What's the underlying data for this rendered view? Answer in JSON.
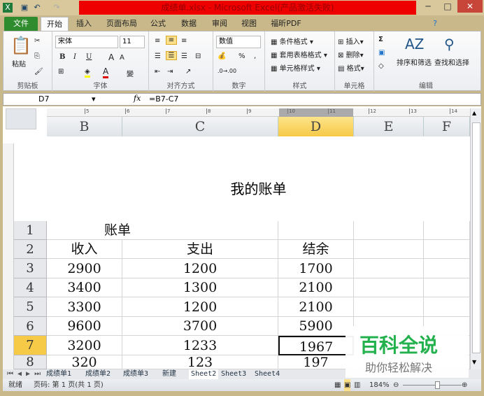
{
  "window": {
    "title": "成绩单.xlsx - Microsoft Excel(产品激活失败)",
    "minimize": "─",
    "maximize": "□",
    "close": "✕"
  },
  "ribbon_tabs": [
    "文件",
    "开始",
    "插入",
    "页面布局",
    "公式",
    "数据",
    "审阅",
    "视图",
    "福昕PDF"
  ],
  "ribbon": {
    "clipboard": {
      "paste": "粘贴",
      "label": "剪贴板"
    },
    "font": {
      "name": "宋体",
      "size": "11",
      "bold": "B",
      "italic": "I",
      "underline": "U",
      "grow": "A",
      "shrink": "A",
      "label": "字体"
    },
    "alignment": {
      "label": "对齐方式"
    },
    "number": {
      "format": "数值",
      "percent": "%",
      "comma": ",",
      "label": "数字"
    },
    "styles": {
      "conditional": "条件格式",
      "table": "套用表格格式",
      "cell": "单元格样式",
      "label": "样式"
    },
    "cells": {
      "insert": "插入",
      "delete": "删除",
      "format": "格式",
      "label": "单元格"
    },
    "editing": {
      "sort": "排序和筛选",
      "find": "查找和选择",
      "sigma": "Σ",
      "label": "编辑"
    }
  },
  "formula_bar": {
    "name_box": "D7",
    "fx": "fx",
    "formula": "=B7-C7"
  },
  "ruler_ticks": [
    "5",
    "6",
    "7",
    "8",
    "9",
    "10",
    "11",
    "12",
    "13",
    "14"
  ],
  "columns": [
    "B",
    "C",
    "D",
    "E",
    "F"
  ],
  "active_column": "D",
  "page_header": "我的账单",
  "rows": [
    {
      "n": "1",
      "cells": [
        "账单",
        "",
        "",
        ""
      ]
    },
    {
      "n": "2",
      "cells": [
        "收入",
        "支出",
        "结余",
        ""
      ]
    },
    {
      "n": "3",
      "cells": [
        "2900",
        "1200",
        "1700",
        ""
      ]
    },
    {
      "n": "4",
      "cells": [
        "3400",
        "1300",
        "2100",
        ""
      ]
    },
    {
      "n": "5",
      "cells": [
        "3300",
        "1200",
        "2100",
        ""
      ]
    },
    {
      "n": "6",
      "cells": [
        "9600",
        "3700",
        "5900",
        ""
      ]
    },
    {
      "n": "7",
      "cells": [
        "3200",
        "1233",
        "1967",
        ""
      ]
    },
    {
      "n": "8",
      "cells": [
        "320",
        "123",
        "197",
        ""
      ]
    }
  ],
  "active_row": "7",
  "sheet_tabs": [
    "成绩单1",
    "成绩单2",
    "成绩单3",
    "新建",
    "Sheet2",
    "Sheet3",
    "Sheet4"
  ],
  "active_sheet": "Sheet2",
  "status": {
    "ready": "就绪",
    "page": "页码: 第 1 页(共 1 页)",
    "zoom": "184%"
  },
  "watermark": {
    "title": "百科全说",
    "subtitle": "助你轻松解决"
  },
  "colors": {
    "title_red": "#ee0000",
    "file_tab": "#2e8b2e",
    "active_header": "#f6c947",
    "watermark_green": "#22b14c"
  }
}
